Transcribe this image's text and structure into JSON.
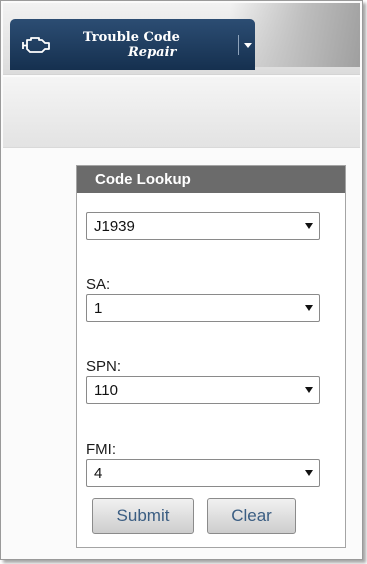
{
  "app": {
    "title_line1": "Trouble Code",
    "title_line2": "Repair",
    "logo_icon": "engine-icon",
    "menu_icon": "caret-down-icon"
  },
  "panel": {
    "title": "Code Lookup",
    "protocol": {
      "value": "J1939"
    },
    "sa": {
      "label": "SA:",
      "value": "1"
    },
    "spn": {
      "label": "SPN:",
      "value": "110"
    },
    "fmi": {
      "label": "FMI:",
      "value": "4"
    },
    "submit_label": "Submit",
    "clear_label": "Clear"
  },
  "colors": {
    "brand_bar": "#1f3d60",
    "panel_header": "#6b6b6b",
    "button_text": "#3a5d82"
  }
}
